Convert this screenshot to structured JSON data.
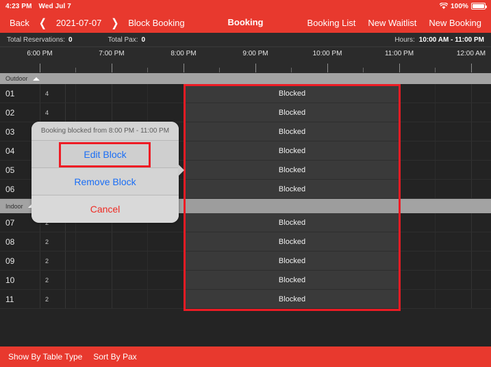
{
  "statusbar": {
    "time": "4:23 PM",
    "date": "Wed Jul 7",
    "wifi_icon": "wifi-icon",
    "battery_percent": "100%",
    "battery_icon": "battery-full-icon"
  },
  "navbar": {
    "back_label": "Back",
    "prev_icon": "chevron-left-icon",
    "date": "2021-07-07",
    "next_icon": "chevron-right-icon",
    "mode_label": "Block Booking",
    "title": "Booking",
    "booking_list_label": "Booking List",
    "new_waitlist_label": "New Waitlist",
    "new_booking_label": "New Booking"
  },
  "summary": {
    "total_reservations_label": "Total Reservations:",
    "total_reservations_value": "0",
    "total_pax_label": "Total Pax:",
    "total_pax_value": "0",
    "hours_label": "Hours:",
    "hours_value": "10:00 AM - 11:00 PM"
  },
  "ruler": {
    "labels": [
      "6:00 PM",
      "7:00 PM",
      "8:00 PM",
      "9:00 PM",
      "10:00 PM",
      "11:00 PM",
      "12:00 AM"
    ],
    "positions": [
      58,
      163,
      268,
      373,
      478,
      583,
      688
    ],
    "minor_positions": [
      110,
      215,
      320,
      425,
      530,
      635
    ]
  },
  "sections": [
    {
      "name": "Outdoor",
      "caret_icon": "caret-up-icon",
      "rows": [
        {
          "number": "01",
          "pax": "4",
          "blocked_label": "Blocked"
        },
        {
          "number": "02",
          "pax": "4",
          "blocked_label": "Blocked"
        },
        {
          "number": "03",
          "pax": "",
          "blocked_label": "Blocked"
        },
        {
          "number": "04",
          "pax": "",
          "blocked_label": "Blocked"
        },
        {
          "number": "05",
          "pax": "",
          "blocked_label": "Blocked"
        },
        {
          "number": "06",
          "pax": "",
          "blocked_label": "Blocked"
        }
      ]
    },
    {
      "name": "Indoor",
      "caret_icon": "caret-up-icon",
      "rows": [
        {
          "number": "07",
          "pax": "2",
          "blocked_label": "Blocked"
        },
        {
          "number": "08",
          "pax": "2",
          "blocked_label": "Blocked"
        },
        {
          "number": "09",
          "pax": "2",
          "blocked_label": "Blocked"
        },
        {
          "number": "10",
          "pax": "2",
          "blocked_label": "Blocked"
        },
        {
          "number": "11",
          "pax": "2",
          "blocked_label": "Blocked"
        }
      ]
    }
  ],
  "popover": {
    "title": "Booking blocked from 8:00 PM - 11:00 PM",
    "edit_label": "Edit Block",
    "remove_label": "Remove Block",
    "cancel_label": "Cancel"
  },
  "bottombar": {
    "show_by_table_type_label": "Show By Table Type",
    "sort_by_pax_label": "Sort By Pax"
  },
  "colors": {
    "brand_red": "#e8392e",
    "highlight_red": "#ee1b24",
    "link_blue": "#1a6ef5",
    "cancel_red": "#ee2b23",
    "section_gray": "#a3a3a3",
    "blocked_cell": "#3a3a3a"
  }
}
